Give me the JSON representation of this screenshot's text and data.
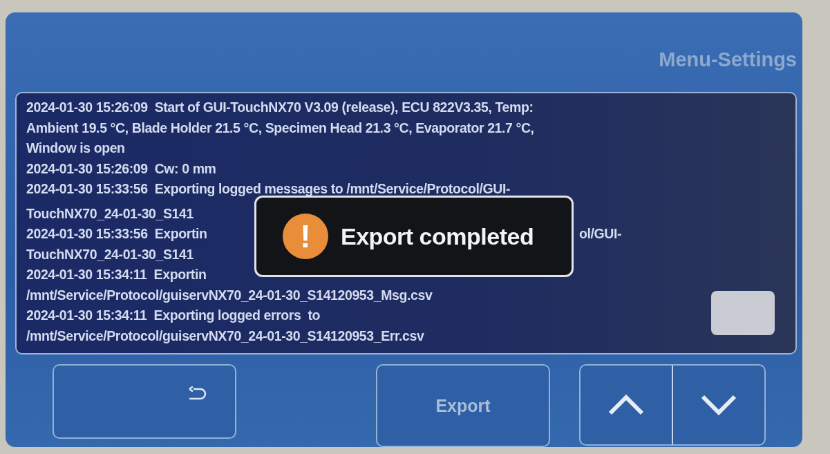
{
  "title": "Menu-Settings",
  "log": [
    {
      "parts": [
        "2024-01-30 15:26:09  Start of GUI-TouchNX70 V3.09 (release), ECU 822V3.35, Temp:"
      ]
    },
    {
      "parts": [
        "Ambient 19.5 °C, Blade Holder 21.5 °C, Specimen Head 21.3 °C, Evaporator 21.7 °C,"
      ]
    },
    {
      "parts": [
        "Window is open"
      ]
    },
    {
      "parts": [
        "2024-01-30 15:26:09  Cw: 0 mm"
      ]
    },
    {
      "parts": [
        "2024-01-30 15:33:56  Exporting logged messages to /mnt/Service/Protocol/GUI-"
      ]
    },
    {
      "parts": [
        "TouchNX70_24-01-30_S141"
      ]
    },
    {
      "parts": [
        "2024-01-30 15:33:56  Exportin",
        "ol/GUI-"
      ]
    },
    {
      "parts": [
        "TouchNX70_24-01-30_S141"
      ]
    },
    {
      "parts": [
        "2024-01-30 15:34:11  Exportin"
      ]
    },
    {
      "parts": [
        "/mnt/Service/Protocol/guiservNX70_24-01-30_S14120953_Msg.csv"
      ]
    },
    {
      "parts": [
        "2024-01-30 15:34:11  Exporting logged errors  to"
      ]
    },
    {
      "parts": [
        "/mnt/Service/Protocol/guiservNX70_24-01-30_S14120953_Err.csv"
      ]
    }
  ],
  "dialog": {
    "icon": "!",
    "message": "Export completed"
  },
  "buttons": [
    {
      "kind": "back"
    },
    {
      "kind": "text",
      "label": "Export"
    },
    {
      "kind": "arrows"
    }
  ]
}
